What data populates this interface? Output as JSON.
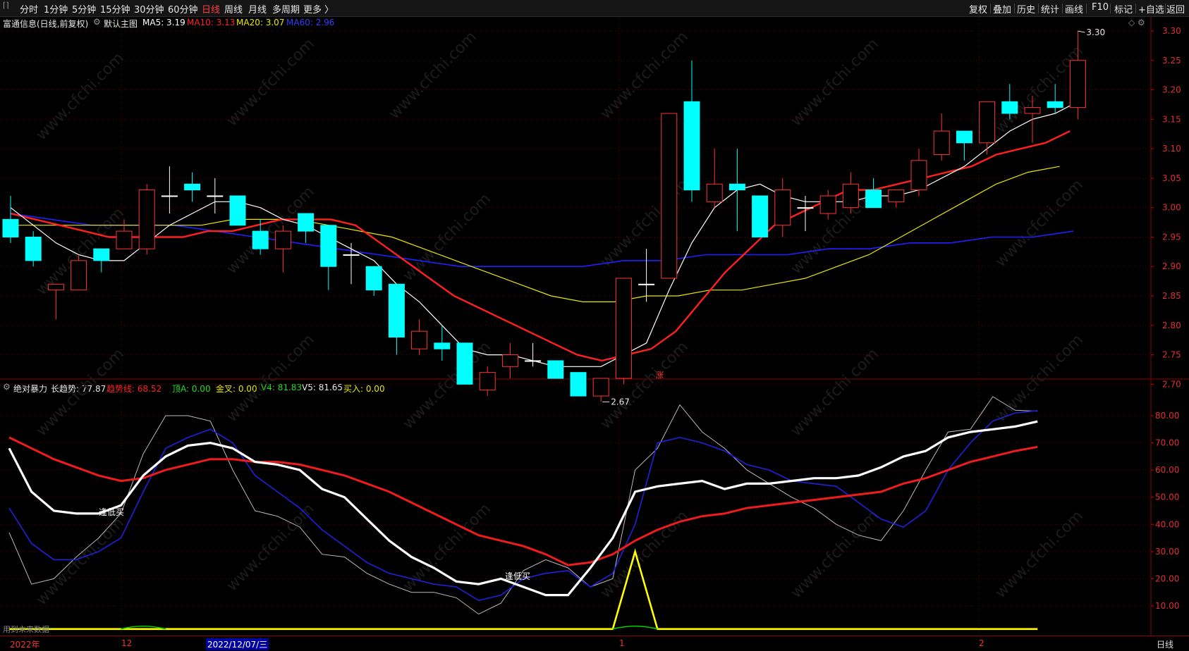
{
  "toolbar": {
    "periods": [
      "分时",
      "1分钟",
      "5分钟",
      "15分钟",
      "30分钟",
      "60分钟",
      "日线",
      "周线",
      "月线",
      "多周期",
      "更多 〉"
    ],
    "active_period": "日线",
    "right_buttons": [
      "复权",
      "叠加",
      "历史",
      "统计",
      "画线",
      "F10",
      "标记",
      "+自选",
      "返回"
    ]
  },
  "main_info": {
    "stock": "富通信息(日线,前复权)",
    "template": "默认主图",
    "ma5": "MA5: 3.19",
    "ma10": "MA10: 3.13",
    "ma20": "MA20: 3.07",
    "ma60": "MA60: 2.96"
  },
  "sub_info": {
    "indicator": "绝对暴力",
    "long_trend": "长趋势: 77.87",
    "trend_line": "趋势线: 68.52",
    "top_a": "顶A: 0.00",
    "golden": "金叉: 0.00",
    "v4": "V4: 81.83",
    "v5": "V5: 81.65",
    "buy": "买入: 0.00"
  },
  "annotations": {
    "high": "3.30",
    "low": "2.67",
    "zhang": "涨",
    "low_buy_1": "逢低买",
    "low_buy_2": "逢低买",
    "watermark": "www.cfchi.com",
    "footer_note": "用到未来数据"
  },
  "price_axis": [
    "3.30",
    "3.25",
    "3.20",
    "3.15",
    "3.10",
    "3.05",
    "3.00",
    "2.95",
    "2.90",
    "2.85",
    "2.80",
    "2.75",
    "2.70"
  ],
  "ind_axis": [
    "80.00",
    "70.00",
    "60.00",
    "50.00",
    "40.00",
    "30.00",
    "20.00",
    "10.00"
  ],
  "date_axis": {
    "year": "2022年",
    "m12": "12",
    "cursor": "2022/12/07/三",
    "jan": "1",
    "feb": "2",
    "period": "日线"
  },
  "colors": {
    "up": "#ff3333",
    "down": "#00ffff",
    "ma5": "#ffffff",
    "ma10": "#ff2020",
    "ma20": "#e8e800",
    "ma60": "#2020ff",
    "grid": "#5a0000"
  },
  "chart_data": {
    "type": "candlestick",
    "candles": [
      {
        "o": 2.98,
        "h": 3.02,
        "l": 2.94,
        "c": 2.95
      },
      {
        "o": 2.95,
        "h": 2.96,
        "l": 2.9,
        "c": 2.91
      },
      {
        "o": 2.86,
        "h": 2.87,
        "l": 2.81,
        "c": 2.87
      },
      {
        "o": 2.86,
        "h": 2.92,
        "l": 2.86,
        "c": 2.91
      },
      {
        "o": 2.93,
        "h": 2.93,
        "l": 2.89,
        "c": 2.91
      },
      {
        "o": 2.93,
        "h": 2.98,
        "l": 2.93,
        "c": 2.96
      },
      {
        "o": 2.93,
        "h": 3.04,
        "l": 2.92,
        "c": 3.03
      },
      {
        "o": 3.02,
        "h": 3.07,
        "l": 2.99,
        "c": 3.02
      },
      {
        "o": 3.04,
        "h": 3.06,
        "l": 3.01,
        "c": 3.03
      },
      {
        "o": 3.02,
        "h": 3.05,
        "l": 2.99,
        "c": 3.02
      },
      {
        "o": 3.02,
        "h": 3.02,
        "l": 2.97,
        "c": 2.97
      },
      {
        "o": 2.96,
        "h": 2.98,
        "l": 2.92,
        "c": 2.93
      },
      {
        "o": 2.93,
        "h": 2.97,
        "l": 2.89,
        "c": 2.96
      },
      {
        "o": 2.99,
        "h": 2.99,
        "l": 2.94,
        "c": 2.96
      },
      {
        "o": 2.97,
        "h": 2.97,
        "l": 2.86,
        "c": 2.9
      },
      {
        "o": 2.92,
        "h": 2.94,
        "l": 2.87,
        "c": 2.92
      },
      {
        "o": 2.9,
        "h": 2.9,
        "l": 2.85,
        "c": 2.86
      },
      {
        "o": 2.87,
        "h": 2.87,
        "l": 2.75,
        "c": 2.78
      },
      {
        "o": 2.76,
        "h": 2.81,
        "l": 2.75,
        "c": 2.79
      },
      {
        "o": 2.77,
        "h": 2.8,
        "l": 2.74,
        "c": 2.76
      },
      {
        "o": 2.77,
        "h": 2.77,
        "l": 2.7,
        "c": 2.7
      },
      {
        "o": 2.69,
        "h": 2.73,
        "l": 2.68,
        "c": 2.72
      },
      {
        "o": 2.73,
        "h": 2.77,
        "l": 2.71,
        "c": 2.75
      },
      {
        "o": 2.74,
        "h": 2.77,
        "l": 2.73,
        "c": 2.74
      },
      {
        "o": 2.74,
        "h": 2.74,
        "l": 2.71,
        "c": 2.71
      },
      {
        "o": 2.72,
        "h": 2.72,
        "l": 2.68,
        "c": 2.68
      },
      {
        "o": 2.68,
        "h": 2.71,
        "l": 2.67,
        "c": 2.71
      },
      {
        "o": 2.71,
        "h": 2.84,
        "l": 2.7,
        "c": 2.88
      },
      {
        "o": 2.87,
        "h": 2.93,
        "l": 2.84,
        "c": 2.87
      },
      {
        "o": 2.88,
        "h": 3.16,
        "l": 2.88,
        "c": 3.16
      },
      {
        "o": 3.18,
        "h": 3.25,
        "l": 3.01,
        "c": 3.03
      },
      {
        "o": 3.01,
        "h": 3.1,
        "l": 3.0,
        "c": 3.04
      },
      {
        "o": 3.04,
        "h": 3.1,
        "l": 2.96,
        "c": 3.03
      },
      {
        "o": 3.02,
        "h": 3.02,
        "l": 2.95,
        "c": 2.95
      },
      {
        "o": 2.97,
        "h": 3.05,
        "l": 2.95,
        "c": 3.03
      },
      {
        "o": 3.0,
        "h": 3.02,
        "l": 2.96,
        "c": 3.0
      },
      {
        "o": 2.99,
        "h": 3.03,
        "l": 2.98,
        "c": 3.02
      },
      {
        "o": 3.0,
        "h": 3.06,
        "l": 2.99,
        "c": 3.04
      },
      {
        "o": 3.03,
        "h": 3.05,
        "l": 3.0,
        "c": 3.0
      },
      {
        "o": 3.01,
        "h": 3.03,
        "l": 3.0,
        "c": 3.03
      },
      {
        "o": 3.03,
        "h": 3.1,
        "l": 3.02,
        "c": 3.08
      },
      {
        "o": 3.09,
        "h": 3.16,
        "l": 3.08,
        "c": 3.13
      },
      {
        "o": 3.13,
        "h": 3.13,
        "l": 3.08,
        "c": 3.11
      },
      {
        "o": 3.11,
        "h": 3.18,
        "l": 3.09,
        "c": 3.18
      },
      {
        "o": 3.18,
        "h": 3.21,
        "l": 3.15,
        "c": 3.16
      },
      {
        "o": 3.16,
        "h": 3.19,
        "l": 3.11,
        "c": 3.17
      },
      {
        "o": 3.18,
        "h": 3.21,
        "l": 3.16,
        "c": 3.17
      },
      {
        "o": 3.17,
        "h": 3.3,
        "l": 3.15,
        "c": 3.25
      }
    ],
    "ma5": [
      3.0,
      2.97,
      2.94,
      2.92,
      2.91,
      2.91,
      2.94,
      2.97,
      2.99,
      3.01,
      3.01,
      3.0,
      2.98,
      2.97,
      2.95,
      2.93,
      2.91,
      2.87,
      2.84,
      2.8,
      2.76,
      2.75,
      2.75,
      2.74,
      2.73,
      2.73,
      2.73,
      2.75,
      2.77,
      2.86,
      2.94,
      3.0,
      3.03,
      3.04,
      3.02,
      3.01,
      3.01,
      3.01,
      3.02,
      3.02,
      3.03,
      3.05,
      3.07,
      3.1,
      3.13,
      3.15,
      3.16,
      3.18
    ],
    "ma10": [
      2.99,
      2.98,
      2.97,
      2.96,
      2.95,
      2.95,
      2.95,
      2.95,
      2.96,
      2.96,
      2.97,
      2.98,
      2.98,
      2.98,
      2.97,
      2.94,
      2.91,
      2.88,
      2.85,
      2.83,
      2.81,
      2.79,
      2.77,
      2.75,
      2.74,
      2.75,
      2.76,
      2.79,
      2.84,
      2.89,
      2.93,
      2.97,
      2.99,
      3.01,
      3.03,
      3.03,
      3.04,
      3.05,
      3.06,
      3.07,
      3.09,
      3.1,
      3.11,
      3.13
    ],
    "ma20": [
      2.97,
      2.97,
      2.97,
      2.97,
      2.97,
      2.97,
      2.97,
      2.98,
      2.98,
      2.98,
      2.97,
      2.96,
      2.95,
      2.93,
      2.91,
      2.89,
      2.87,
      2.85,
      2.84,
      2.84,
      2.85,
      2.85,
      2.86,
      2.86,
      2.87,
      2.88,
      2.9,
      2.92,
      2.95,
      2.98,
      3.01,
      3.04,
      3.06,
      3.07
    ],
    "ma60": [
      2.99,
      2.98,
      2.97,
      2.97,
      2.97,
      2.96,
      2.95,
      2.94,
      2.93,
      2.92,
      2.91,
      2.9,
      2.9,
      2.9,
      2.9,
      2.91,
      2.91,
      2.92,
      2.92,
      2.92,
      2.93,
      2.93,
      2.94,
      2.94,
      2.95,
      2.95,
      2.96
    ],
    "ind": {
      "long_trend": [
        68,
        52,
        45,
        44,
        44,
        47,
        58,
        65,
        69,
        70,
        68,
        63,
        62,
        60,
        53,
        50,
        42,
        34,
        28,
        24,
        19,
        18,
        20,
        17,
        14,
        14,
        24,
        35,
        52,
        54,
        55,
        56,
        53,
        55,
        55,
        56,
        57,
        57,
        58,
        61,
        65,
        67,
        72,
        74,
        75,
        76,
        77.87
      ],
      "trend_line": [
        72,
        68,
        64,
        61,
        58,
        56,
        57,
        60,
        62,
        64,
        64,
        63,
        63,
        62,
        60,
        58,
        55,
        52,
        48,
        44,
        40,
        36,
        34,
        32,
        29,
        25,
        26,
        29,
        34,
        38,
        41,
        43,
        44,
        46,
        47,
        48,
        49,
        50,
        51,
        52,
        55,
        57,
        60,
        63,
        65,
        67,
        68.52
      ],
      "v4": [
        46,
        33,
        27,
        27,
        30,
        35,
        52,
        68,
        72,
        75,
        70,
        58,
        52,
        46,
        38,
        32,
        26,
        22,
        20,
        18,
        17,
        12,
        14,
        20,
        22,
        23,
        17,
        22,
        40,
        70,
        72,
        70,
        67,
        62,
        60,
        56,
        55,
        54,
        48,
        42,
        39,
        45,
        60,
        70,
        78,
        81,
        81.83
      ],
      "v5": [
        37,
        18,
        20,
        28,
        35,
        44,
        66,
        80,
        80,
        78,
        60,
        45,
        43,
        39,
        29,
        28,
        22,
        18,
        15,
        15,
        13,
        7,
        11,
        23,
        27,
        24,
        17,
        20,
        60,
        68,
        84,
        74,
        68,
        60,
        55,
        50,
        46,
        40,
        36,
        34,
        45,
        60,
        74,
        75,
        87,
        82,
        81.65
      ],
      "buy": [
        0,
        0,
        0,
        0,
        0,
        0,
        0,
        0,
        0,
        0,
        0,
        0,
        0,
        0,
        0,
        0,
        0,
        0,
        0,
        0,
        0,
        0,
        0,
        0,
        0,
        0,
        0,
        0,
        30,
        0,
        0,
        0,
        0,
        0,
        0,
        0,
        0,
        0,
        0,
        0,
        0,
        0,
        0,
        0,
        0,
        0,
        0
      ]
    }
  }
}
